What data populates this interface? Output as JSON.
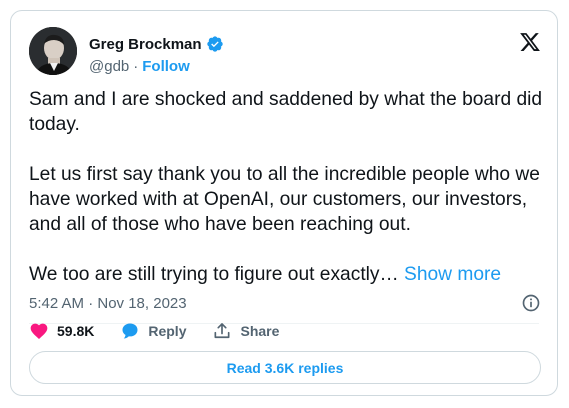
{
  "author": {
    "name": "Greg Brockman",
    "handle": "@gdb",
    "separator": "·",
    "follow_label": "Follow"
  },
  "tweet": {
    "paragraphs": [
      "Sam and I are shocked and saddened by what the board did today.",
      "Let us first say thank you to all the incredible people who we have worked with at OpenAI, our customers, our investors, and all of those who have been reaching out.",
      "We too are still trying to figure out exactly…"
    ],
    "show_more_label": "Show more",
    "timestamp": "5:42 AM · Nov 18, 2023"
  },
  "actions": {
    "like_count": "59.8K",
    "reply_label": "Reply",
    "share_label": "Share"
  },
  "read_replies_label": "Read 3.6K replies",
  "colors": {
    "accent": "#1d9bf0",
    "like": "#f91880",
    "text": "#0f1419",
    "secondary": "#536471",
    "border": "#cfd9de"
  },
  "icons": [
    "verified-badge-icon",
    "x-logo-icon",
    "info-icon",
    "heart-icon",
    "reply-bubble-icon",
    "share-icon"
  ]
}
